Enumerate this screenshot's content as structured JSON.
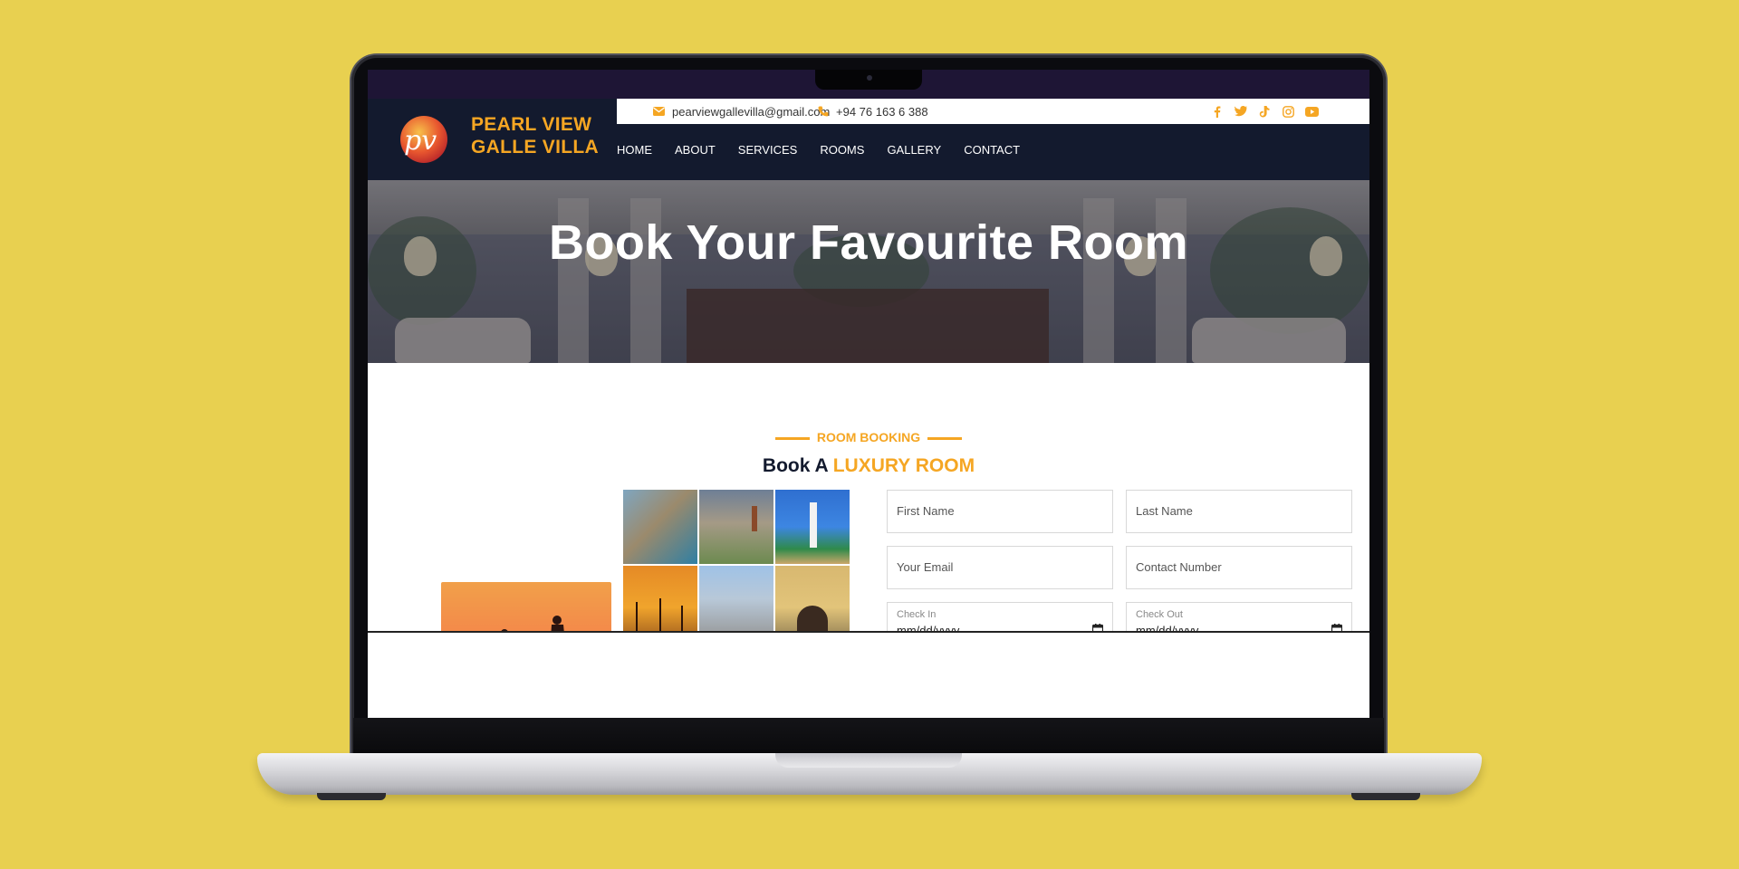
{
  "site": {
    "brand_line1": "PEARL VIEW",
    "brand_line2": "GALLE VILLA",
    "logo_text": "pv"
  },
  "topbar": {
    "email": "pearviewgallevilla@gmail.com",
    "phone": "+94 76 163 6 388",
    "social_icons": [
      "facebook-icon",
      "twitter-icon",
      "tiktok-icon",
      "instagram-icon",
      "youtube-icon"
    ]
  },
  "nav": {
    "items": [
      "HOME",
      "ABOUT",
      "SERVICES",
      "ROOMS",
      "GALLERY",
      "CONTACT"
    ]
  },
  "hero": {
    "title": "Book Your Favourite Room"
  },
  "booking": {
    "eyebrow": "ROOM BOOKING",
    "title_plain": "Book A",
    "title_accent": "LUXURY ROOM",
    "first_name_placeholder": "First Name",
    "last_name_placeholder": "Last Name",
    "email_placeholder": "Your Email",
    "contact_placeholder": "Contact Number",
    "check_in_label": "Check In",
    "check_in_value": "mm/dd/yyyy",
    "check_out_label": "Check Out",
    "check_out_value": "mm/dd/yyyy"
  },
  "colors": {
    "background": "#E8D050",
    "accent": "#F5A623",
    "navy": "#131a2e"
  }
}
